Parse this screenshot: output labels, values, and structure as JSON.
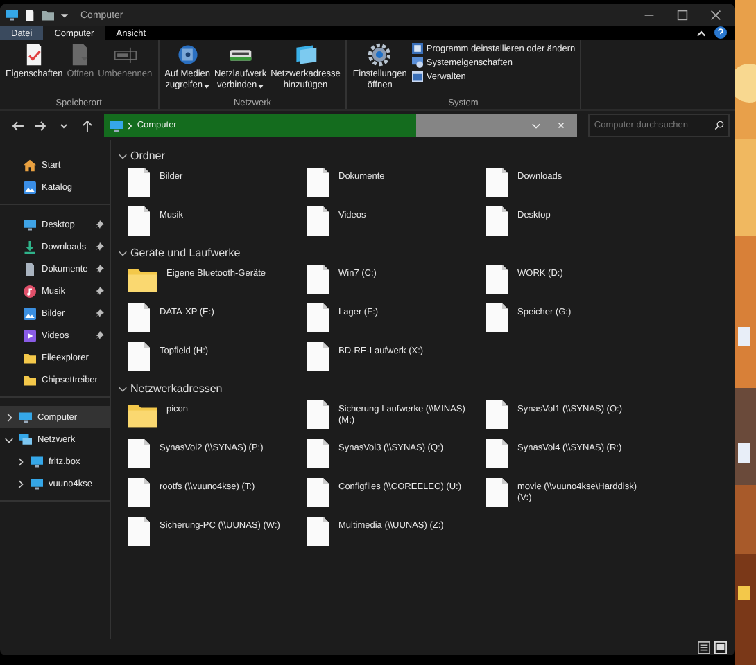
{
  "window": {
    "title": "Computer"
  },
  "ribbon_tabs": [
    {
      "label": "Datei",
      "kind": "file"
    },
    {
      "label": "Computer",
      "kind": "tab",
      "selected": true
    },
    {
      "label": "Ansicht",
      "kind": "tab",
      "selected": false
    }
  ],
  "ribbon_groups": [
    {
      "label": "Speicherort",
      "buttons": [
        {
          "lines": [
            "Eigenschaften"
          ],
          "kind": "properties",
          "disabled": false,
          "dropdown": false
        },
        {
          "lines": [
            "Öffnen"
          ],
          "kind": "open",
          "disabled": true,
          "dropdown": false
        },
        {
          "lines": [
            "Umbenennen"
          ],
          "kind": "rename",
          "disabled": true,
          "dropdown": false
        }
      ]
    },
    {
      "label": "Netzwerk",
      "buttons": [
        {
          "lines": [
            "Auf Medien",
            "zugreifen"
          ],
          "kind": "media",
          "disabled": false,
          "dropdown": true
        },
        {
          "lines": [
            "Netzlaufwerk",
            "verbinden"
          ],
          "kind": "drive",
          "disabled": false,
          "dropdown": true
        },
        {
          "lines": [
            "Netzwerkadresse",
            "hinzufügen"
          ],
          "kind": "location",
          "disabled": false,
          "dropdown": false
        }
      ]
    },
    {
      "label": "System",
      "buttons": [
        {
          "lines": [
            "Einstellungen",
            "öffnen"
          ],
          "kind": "settings",
          "disabled": false,
          "dropdown": false
        }
      ],
      "small_buttons": [
        {
          "label": "Programm deinstallieren oder ändern",
          "kind": "uninstall"
        },
        {
          "label": "Systemeigenschaften",
          "kind": "sysprops"
        },
        {
          "label": "Verwalten",
          "kind": "manage"
        }
      ]
    }
  ],
  "address": {
    "path": "Computer",
    "level": 0.66
  },
  "search": {
    "placeholder": "Computer durchsuchen"
  },
  "sidebar": {
    "quick": [
      {
        "label": "Start",
        "kind": "home"
      },
      {
        "label": "Katalog",
        "kind": "gallery"
      }
    ],
    "pinned": [
      {
        "label": "Desktop",
        "kind": "desktop",
        "pinned": true
      },
      {
        "label": "Downloads",
        "kind": "download",
        "pinned": true
      },
      {
        "label": "Dokumente",
        "kind": "document",
        "pinned": true
      },
      {
        "label": "Musik",
        "kind": "music",
        "pinned": true
      },
      {
        "label": "Bilder",
        "kind": "picture",
        "pinned": true
      },
      {
        "label": "Videos",
        "kind": "video",
        "pinned": true
      },
      {
        "label": "Fileexplorer",
        "kind": "folder",
        "pinned": false
      },
      {
        "label": "Chipsettreiber",
        "kind": "folder",
        "pinned": false
      }
    ],
    "tree": [
      {
        "label": "Computer",
        "kind": "computer",
        "selected": true,
        "expanded": false
      },
      {
        "label": "Netzwerk",
        "kind": "network",
        "selected": false,
        "expanded": true,
        "children": [
          {
            "label": "fritz.box",
            "kind": "computer",
            "selected": false,
            "expanded": false
          },
          {
            "label": "vuuno4kse",
            "kind": "computer",
            "selected": false,
            "expanded": false
          }
        ]
      }
    ]
  },
  "sections": [
    {
      "title": "Ordner",
      "expanded": true,
      "items": [
        {
          "name": "Bilder",
          "kind": "file"
        },
        {
          "name": "Dokumente",
          "kind": "file"
        },
        {
          "name": "Downloads",
          "kind": "file"
        },
        {
          "name": "Musik",
          "kind": "file"
        },
        {
          "name": "Videos",
          "kind": "file"
        },
        {
          "name": "Desktop",
          "kind": "file"
        }
      ]
    },
    {
      "title": "Geräte und Laufwerke",
      "expanded": true,
      "items": [
        {
          "name": "Eigene Bluetooth-Geräte",
          "kind": "folder"
        },
        {
          "name": "Win7 (C:)",
          "kind": "file"
        },
        {
          "name": "WORK (D:)",
          "kind": "file"
        },
        {
          "name": "DATA-XP (E:)",
          "kind": "file"
        },
        {
          "name": "Lager (F:)",
          "kind": "file"
        },
        {
          "name": "Speicher (G:)",
          "kind": "file"
        },
        {
          "name": "Topfield (H:)",
          "kind": "file"
        },
        {
          "name": "BD-RE-Laufwerk (X:)",
          "kind": "file"
        }
      ]
    },
    {
      "title": "Netzwerkadressen",
      "expanded": true,
      "items": [
        {
          "name": "picon",
          "kind": "folder"
        },
        {
          "name": "Sicherung Laufwerke (\\\\MINAS) (M:)",
          "kind": "file"
        },
        {
          "name": "SynasVol1 (\\\\SYNAS) (O:)",
          "kind": "file"
        },
        {
          "name": "SynasVol2 (\\\\SYNAS) (P:)",
          "kind": "file"
        },
        {
          "name": "SynasVol3 (\\\\SYNAS) (Q:)",
          "kind": "file"
        },
        {
          "name": "SynasVol4 (\\\\SYNAS) (R:)",
          "kind": "file"
        },
        {
          "name": "rootfs (\\\\vuuno4kse) (T:)",
          "kind": "file"
        },
        {
          "name": "Configfiles (\\\\COREELEC) (U:)",
          "kind": "file"
        },
        {
          "name": "movie (\\\\vuuno4kse\\Harddisk) (V:)",
          "kind": "file"
        },
        {
          "name": "Sicherung-PC (\\\\UUNAS) (W:)",
          "kind": "file"
        },
        {
          "name": "Multimedia (\\\\UUNAS) (Z:)",
          "kind": "file"
        }
      ]
    }
  ]
}
